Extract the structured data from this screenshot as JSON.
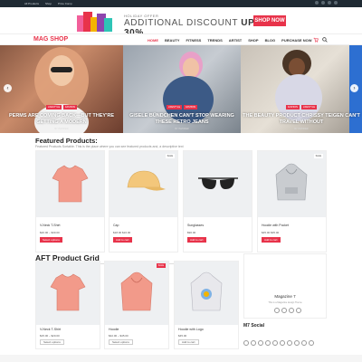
{
  "topbar": {
    "links": [
      "All Products",
      "Shop",
      "Price Comp"
    ]
  },
  "banner": {
    "offer_small": "HOLIDAY OFFER",
    "offer_big": "ADDITIONAL DISCOUNT",
    "offer_pct": "UPTO 30%",
    "shop_now": "SHOP NOW"
  },
  "header": {
    "logo": "MAG SHOP",
    "nav": [
      "HOME",
      "BEAUTY",
      "FITNESS",
      "TRENDS",
      "ARTIST",
      "SHOP",
      "BLOG",
      "PURCHASE NOW"
    ]
  },
  "slider": {
    "slides": [
      {
        "title": "PERMS ARE COMING BACK—BUT THEY'RE GETTING A MODERN",
        "tags": [
          "LIFESTYLE",
          "FASHION"
        ],
        "meta": "BY INVOKER"
      },
      {
        "title": "GISELE BÜNDCHEN CAN'T STOP WEARING THESE RETRO JEANS",
        "tags": [
          "LIFESTYLE",
          "FASHION"
        ],
        "meta": "BY INVOKER"
      },
      {
        "title": "THE BEAUTY PRODUCT CHRISSY TEIGEN CAN'T TRAVEL WITHOUT",
        "tags": [
          "FASHION",
          "LIFESTYLE"
        ],
        "meta": "BY INVOKER"
      }
    ]
  },
  "featured": {
    "title": "Featured Products:",
    "subtitle": "Featured Products Sortable. This is the place where you can see featured products and, a descriptive text",
    "items": [
      {
        "name": "V-Neck T-Shirt",
        "price": "$20.00 – $30.00",
        "cta": "Select options",
        "sale": ""
      },
      {
        "name": "Cap",
        "price": "$18.00 $16.00",
        "cta": "Add to cart",
        "sale": "SALE"
      },
      {
        "name": "Sunglasses",
        "price": "$90.00",
        "cta": "Add to cart",
        "sale": ""
      },
      {
        "name": "Hoodie with Pocket",
        "price": "$45.00 $35.00",
        "cta": "Add to cart",
        "sale": "SALE"
      }
    ]
  },
  "grid": {
    "title": "AFT Product Grid",
    "items": [
      {
        "name": "V-Neck T-Shirt",
        "price": "$15.00 – $20.00",
        "cta": "Select options",
        "badge": ""
      },
      {
        "name": "Hoodie",
        "price": "$42.00 – $45.00",
        "cta": "Select options",
        "badge": "SALE"
      },
      {
        "name": "Hoodie with Logo",
        "price": "$45.00",
        "cta": "Add to cart",
        "badge": ""
      }
    ]
  },
  "sidebar": {
    "magazine_title": "Magazine 7",
    "magazine_sub": "This is a Magazine design Theme",
    "social_title": "M7 Social"
  },
  "colors": {
    "accent": "#e8334a",
    "dark": "#1f2a33"
  }
}
